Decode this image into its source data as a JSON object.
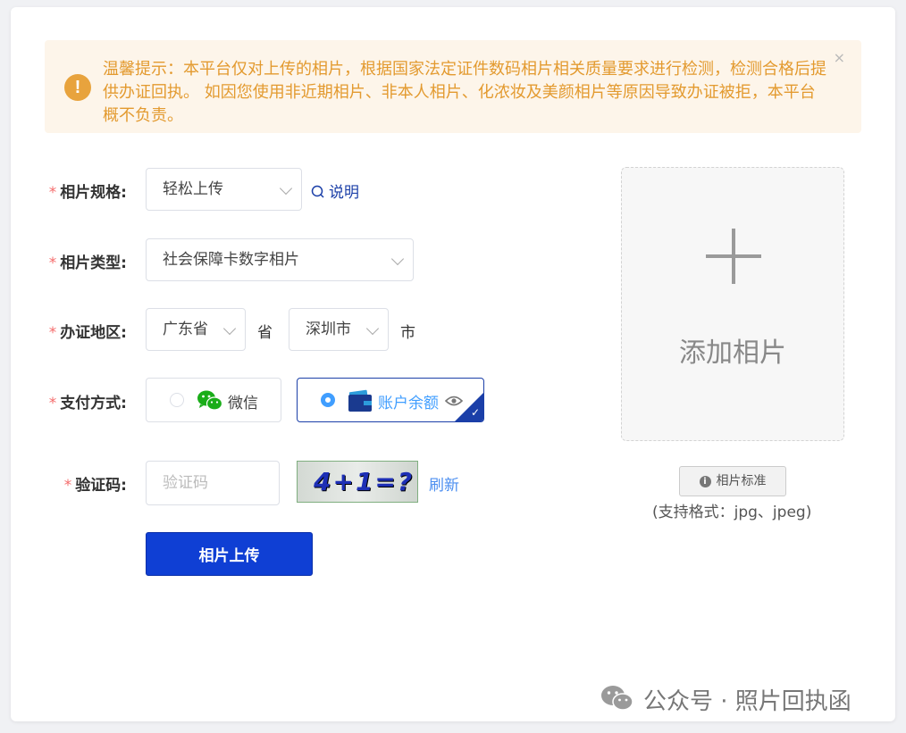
{
  "alert": {
    "text": "温馨提示：本平台仅对上传的相片，根据国家法定证件数码相片相关质量要求进行检测，检测合格后提供办证回执。 如因您使用非近期相片、非本人相片、化浓妆及美颜相片等原因导致办证被拒，本平台概不负责。",
    "close": "×",
    "icon_symbol": "!"
  },
  "form": {
    "required_mark": "*",
    "spec": {
      "label": "相片规格:",
      "value": "轻松上传",
      "help": "说明"
    },
    "type": {
      "label": "相片类型:",
      "value": "社会保障卡数字相片"
    },
    "region": {
      "label": "办证地区:",
      "province": "广东省",
      "province_suffix": "省",
      "city": "深圳市",
      "city_suffix": "市"
    },
    "payment": {
      "label": "支付方式:",
      "options": [
        {
          "label": "微信",
          "selected": false,
          "icon": "wechat-icon"
        },
        {
          "label": "账户余额",
          "selected": true,
          "icon": "wallet-icon"
        }
      ]
    },
    "captcha": {
      "label": "验证码:",
      "placeholder": "验证码",
      "value": "",
      "image_text": "4+1=?",
      "refresh": "刷新"
    },
    "submit": "相片上传"
  },
  "upload": {
    "add_text": "添加相片",
    "standard_button": "相片标准",
    "formats": "(支持格式：jpg、jpeg)"
  },
  "watermark": "公众号 · 照片回执函",
  "colors": {
    "primary": "#0f3fd4",
    "link": "#1b3fa8",
    "alert_text": "#e39a2f",
    "required": "#f56c6c"
  }
}
